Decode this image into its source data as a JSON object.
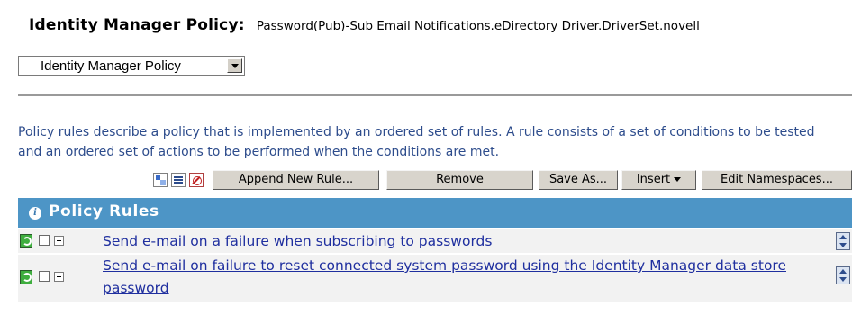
{
  "page": {
    "title_label": "Identity Manager Policy:",
    "title_value": "Password(Pub)-Sub Email Notifications.eDirectory Driver.DriverSet.novell"
  },
  "view_select": {
    "value": "Identity Manager Policy"
  },
  "description": "Policy rules describe a policy that is implemented by an ordered set of rules. A rule consists of a set of conditions to be tested and an ordered set of actions to be performed when the conditions are met.",
  "toolbar": {
    "icons": [
      "expand-all-icon",
      "collapse-all-icon",
      "delete-icon"
    ],
    "append_label": "Append New Rule...",
    "remove_label": "Remove",
    "save_as_label": "Save As...",
    "insert_label": "Insert",
    "edit_ns_label": "Edit Namespaces..."
  },
  "rules_header": {
    "title": "Policy Rules",
    "icon": "info-icon"
  },
  "rules": [
    {
      "label": "Send e-mail on a failure when subscribing to passwords",
      "enabled": true,
      "checked": false
    },
    {
      "label": "Send e-mail on failure to reset connected system password using the Identity Manager data store password",
      "enabled": true,
      "checked": false
    }
  ],
  "colors": {
    "header_bg": "#4d95c6",
    "link": "#1f2f9f",
    "description": "#2d4c8c"
  }
}
